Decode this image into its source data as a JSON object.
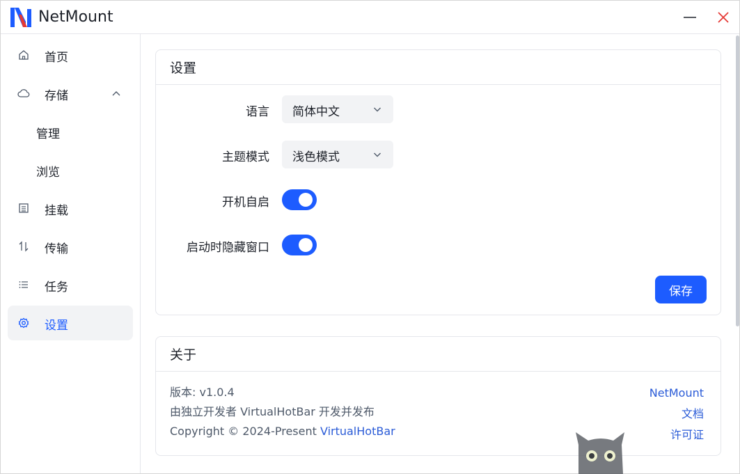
{
  "app": {
    "title": "NetMount"
  },
  "window_controls": {
    "minimize": "minimize-icon",
    "close": "close-icon"
  },
  "sidebar": {
    "items": [
      {
        "label": "首页",
        "icon": "home-icon"
      },
      {
        "label": "存储",
        "icon": "cloud-icon",
        "expanded": true
      },
      {
        "label": "管理"
      },
      {
        "label": "浏览"
      },
      {
        "label": "挂载",
        "icon": "list-box-icon"
      },
      {
        "label": "传输",
        "icon": "transfer-icon"
      },
      {
        "label": "任务",
        "icon": "tasks-icon"
      },
      {
        "label": "设置",
        "icon": "settings-icon",
        "active": true
      }
    ]
  },
  "settings": {
    "title": "设置",
    "language": {
      "label": "语言",
      "value": "简体中文"
    },
    "theme": {
      "label": "主题模式",
      "value": "浅色模式"
    },
    "autostart": {
      "label": "开机自启",
      "on": true
    },
    "hide_on_start": {
      "label": "启动时隐藏窗口",
      "on": true
    },
    "save_label": "保存"
  },
  "about": {
    "title": "关于",
    "version": "版本: v1.0.4",
    "developer": "由独立开发者 VirtualHotBar 开发并发布",
    "copyright_prefix": "Copyright © 2024-Present ",
    "copyright_link": "VirtualHotBar",
    "links": [
      "NetMount",
      "文档",
      "许可证"
    ]
  },
  "colors": {
    "accent": "#1d5cff",
    "link": "#2a5bd7",
    "sidebar_active_bg": "#f2f3f5"
  }
}
